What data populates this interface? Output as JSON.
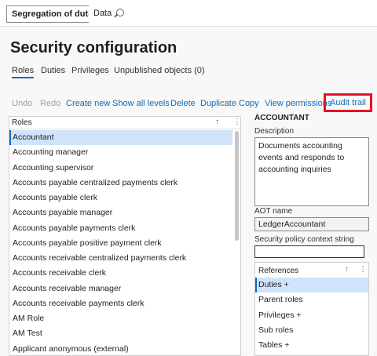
{
  "topbar": {
    "selected_label": "Segregation of duties",
    "data_label": "Data",
    "search_icon": "search-icon"
  },
  "page_title": "Security configuration",
  "tabs": [
    {
      "label": "Roles",
      "active": true
    },
    {
      "label": "Duties",
      "active": false
    },
    {
      "label": "Privileges",
      "active": false
    },
    {
      "label": "Unpublished objects (0)",
      "active": false
    }
  ],
  "toolbar": {
    "undo": "Undo",
    "redo": "Redo",
    "create_new": "Create new",
    "show_all_levels": "Show all levels",
    "delete": "Delete",
    "duplicate": "Duplicate",
    "copy": "Copy",
    "view_permissions": "View permissions",
    "audit_trail": "Audit trail"
  },
  "grid": {
    "header": "Roles",
    "sort_glyph": "↑",
    "more_glyph": "⋮",
    "rows": [
      "Accountant",
      "Accounting manager",
      "Accounting supervisor",
      "Accounts payable centralized payments clerk",
      "Accounts payable clerk",
      "Accounts payable manager",
      "Accounts payable payments clerk",
      "Accounts payable positive payment clerk",
      "Accounts receivable centralized payments clerk",
      "Accounts receivable clerk",
      "Accounts receivable manager",
      "Accounts receivable payments clerk",
      "AM Role",
      "AM Test",
      "Applicant anonymous (external)"
    ],
    "selected_index": 0
  },
  "detail": {
    "title": "ACCOUNTANT",
    "description_label": "Description",
    "description": "Documents accounting events and responds to accounting inquiries",
    "aot_label": "AOT name",
    "aot_value": "LedgerAccountant",
    "context_label": "Security policy context string",
    "context_value": ""
  },
  "references": {
    "header": "References",
    "sort_glyph": "↑",
    "more_glyph": "⋮",
    "rows": [
      "Duties +",
      "Parent roles",
      "Privileges +",
      "Sub roles",
      "Tables +"
    ],
    "selected_index": 0
  },
  "colors": {
    "accent": "#0f6cbd",
    "highlight": "#e81123",
    "selection": "#cfe4fa"
  }
}
